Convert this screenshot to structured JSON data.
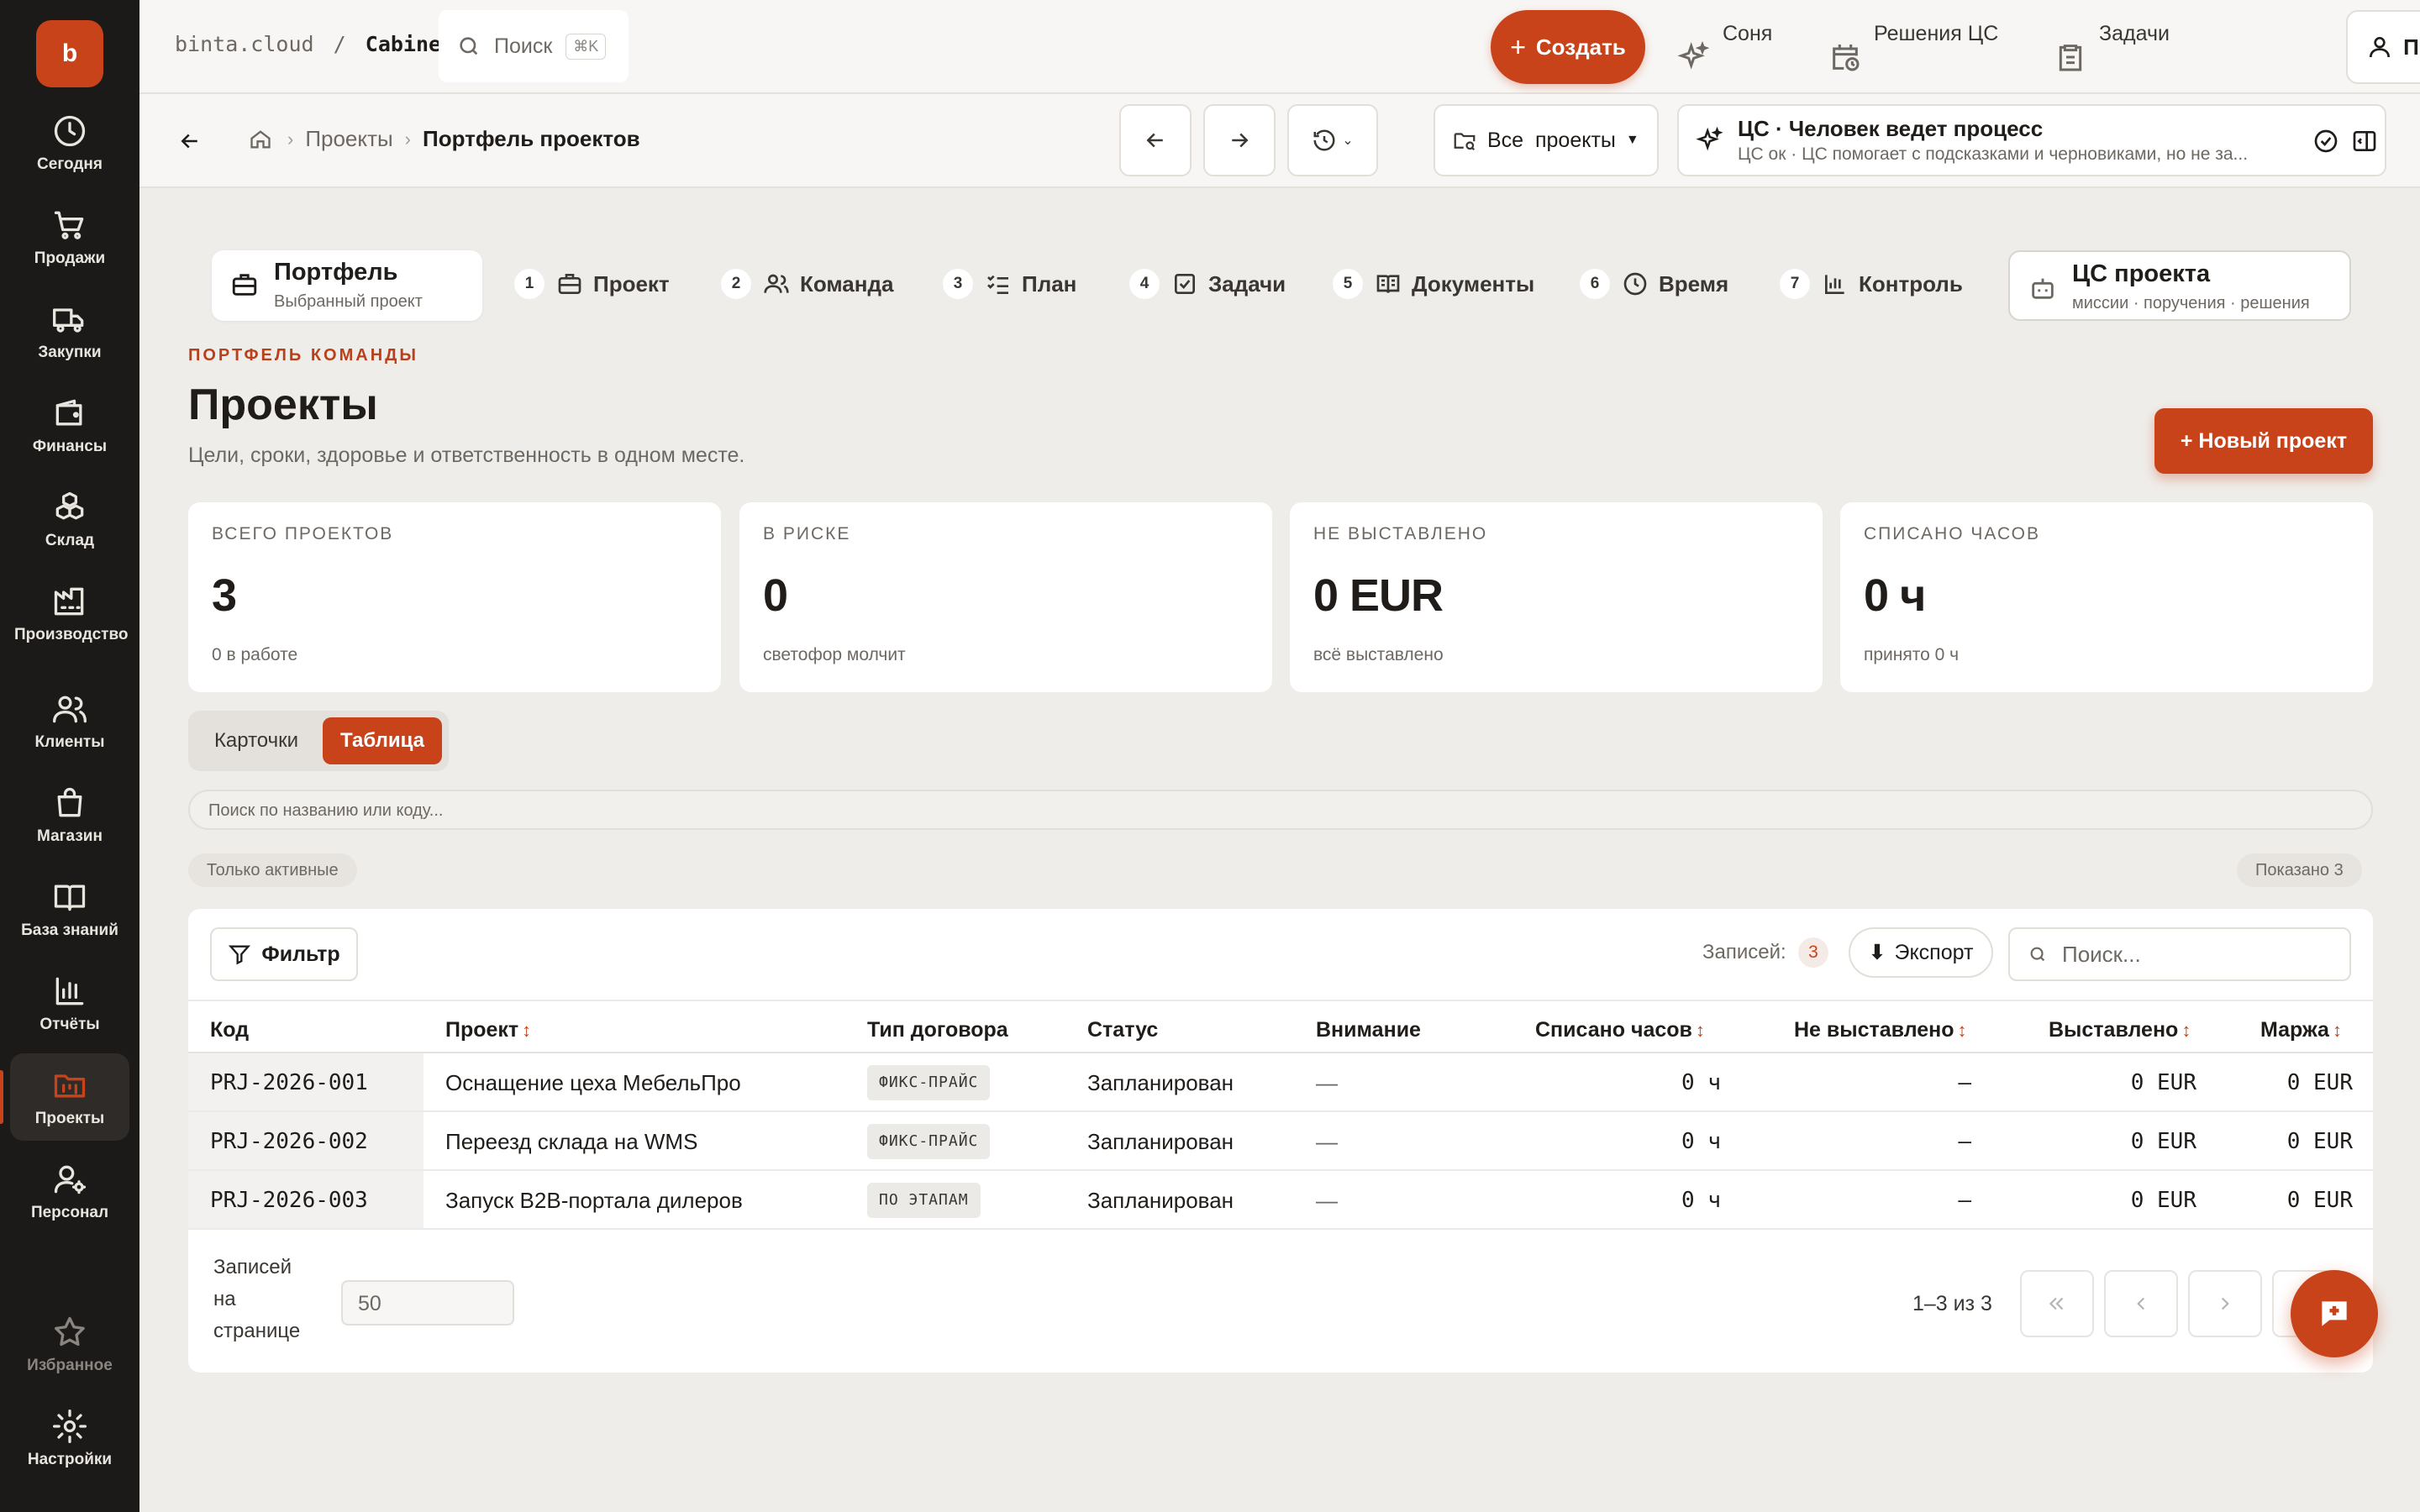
{
  "app": {
    "logo_letter": "b",
    "brand_color": "#c8431a"
  },
  "sidebar": {
    "items": [
      {
        "label": "Сегодня",
        "icon": "clock-icon"
      },
      {
        "label": "Продажи",
        "icon": "cart-icon"
      },
      {
        "label": "Закупки",
        "icon": "truck-icon"
      },
      {
        "label": "Финансы",
        "icon": "wallet-icon"
      },
      {
        "label": "Склад",
        "icon": "boxes-icon"
      },
      {
        "label": "Производство",
        "icon": "factory-icon"
      },
      {
        "label": "Клиенты",
        "icon": "users-icon"
      },
      {
        "label": "Магазин",
        "icon": "bag-icon"
      },
      {
        "label": "База знаний",
        "icon": "book-icon"
      },
      {
        "label": "Отчёты",
        "icon": "bar-chart-icon"
      },
      {
        "label": "Проекты",
        "icon": "folder-kanban-icon",
        "active": true
      },
      {
        "label": "Персонал",
        "icon": "user-cog-icon"
      }
    ],
    "bottom": [
      {
        "label": "Избранное",
        "icon": "star-icon"
      },
      {
        "label": "Настройки",
        "icon": "gear-icon"
      }
    ]
  },
  "topbar": {
    "domain": "binta.cloud",
    "separator": "/",
    "section": "Cabinet",
    "search_label": "Поиск",
    "search_shortcut": "⌘K",
    "create_label": "Создать",
    "links": [
      {
        "label": "Соня",
        "icon": "sparkles-icon"
      },
      {
        "label": "Решения ЦС",
        "icon": "calendar-clock-icon"
      },
      {
        "label": "Задачи",
        "icon": "clipboard-icon"
      }
    ],
    "profile_label": "Профиль"
  },
  "subbar": {
    "breadcrumb": [
      "Проекты",
      "Портфель проектов"
    ],
    "scope_label": "Все  проекты",
    "cs_title": "ЦС · Человек ведет процесс",
    "cs_sub": "ЦС ок · ЦС помогает с подсказками и черновиками, но не за..."
  },
  "tabs": {
    "portfel_title": "Портфель",
    "portfel_sub": "Выбранный проект",
    "steps": [
      {
        "num": "1",
        "label": "Проект",
        "icon": "briefcase-icon"
      },
      {
        "num": "2",
        "label": "Команда",
        "icon": "users-icon"
      },
      {
        "num": "3",
        "label": "План",
        "icon": "list-checks-icon"
      },
      {
        "num": "4",
        "label": "Задачи",
        "icon": "square-check-icon"
      },
      {
        "num": "5",
        "label": "Документы",
        "icon": "book-open-icon"
      },
      {
        "num": "6",
        "label": "Время",
        "icon": "clock-icon"
      },
      {
        "num": "7",
        "label": "Контроль",
        "icon": "bar-chart-icon"
      }
    ],
    "cs_title": "ЦС проекта",
    "cs_sub": "миссии · поручения · решения"
  },
  "header": {
    "eyebrow": "ПОРТФЕЛЬ КОМАНДЫ",
    "title": "Проекты",
    "description": "Цели, сроки, здоровье и ответственность в одном месте.",
    "new_project_label": "+ Новый проект"
  },
  "stats": [
    {
      "label": "ВСЕГО ПРОЕКТОВ",
      "value": "3",
      "note": "0 в работе"
    },
    {
      "label": "В РИСКЕ",
      "value": "0",
      "note": "светофор молчит"
    },
    {
      "label": "НЕ ВЫСТАВЛЕНО",
      "value": "0 EUR",
      "note": "всё выставлено"
    },
    {
      "label": "СПИСАНО ЧАСОВ",
      "value": "0 ч",
      "note": "принято 0 ч"
    }
  ],
  "view": {
    "cards_label": "Карточки",
    "table_label": "Таблица",
    "selected": "Таблица"
  },
  "filters": {
    "search_placeholder": "Поиск по названию или коду...",
    "active_only_label": "Только активные",
    "shown_label": "Показано 3"
  },
  "table": {
    "filter_label": "Фильтр",
    "records_label": "Записей:",
    "records_count": "3",
    "export_label": "Экспорт",
    "search_placeholder": "Поиск...",
    "columns": [
      "Код",
      "Проект",
      "Тип договора",
      "Статус",
      "Внимание",
      "Списано часов",
      "Не выставлено",
      "Выставлено",
      "Маржа"
    ],
    "sort_glyph": "↕",
    "rows": [
      {
        "code": "PRJ-2026-001",
        "project": "Оснащение цеха МебельПро",
        "contract": "ФИКС-ПРАЙС",
        "status": "Запланирован",
        "attention": "—",
        "hours": "0 ч",
        "unbilled": "–",
        "billed": "0 EUR",
        "margin": "0 EUR"
      },
      {
        "code": "PRJ-2026-002",
        "project": "Переезд склада на WMS",
        "contract": "ФИКС-ПРАЙС",
        "status": "Запланирован",
        "attention": "—",
        "hours": "0 ч",
        "unbilled": "–",
        "billed": "0 EUR",
        "margin": "0 EUR"
      },
      {
        "code": "PRJ-2026-003",
        "project": "Запуск B2B-портала дилеров",
        "contract": "ПО ЭТАПАМ",
        "status": "Запланирован",
        "attention": "—",
        "hours": "0 ч",
        "unbilled": "–",
        "billed": "0 EUR",
        "margin": "0 EUR"
      }
    ],
    "page_size_label": "Записей на странице",
    "page_size": "50",
    "range_label": "1–3 из 3"
  }
}
